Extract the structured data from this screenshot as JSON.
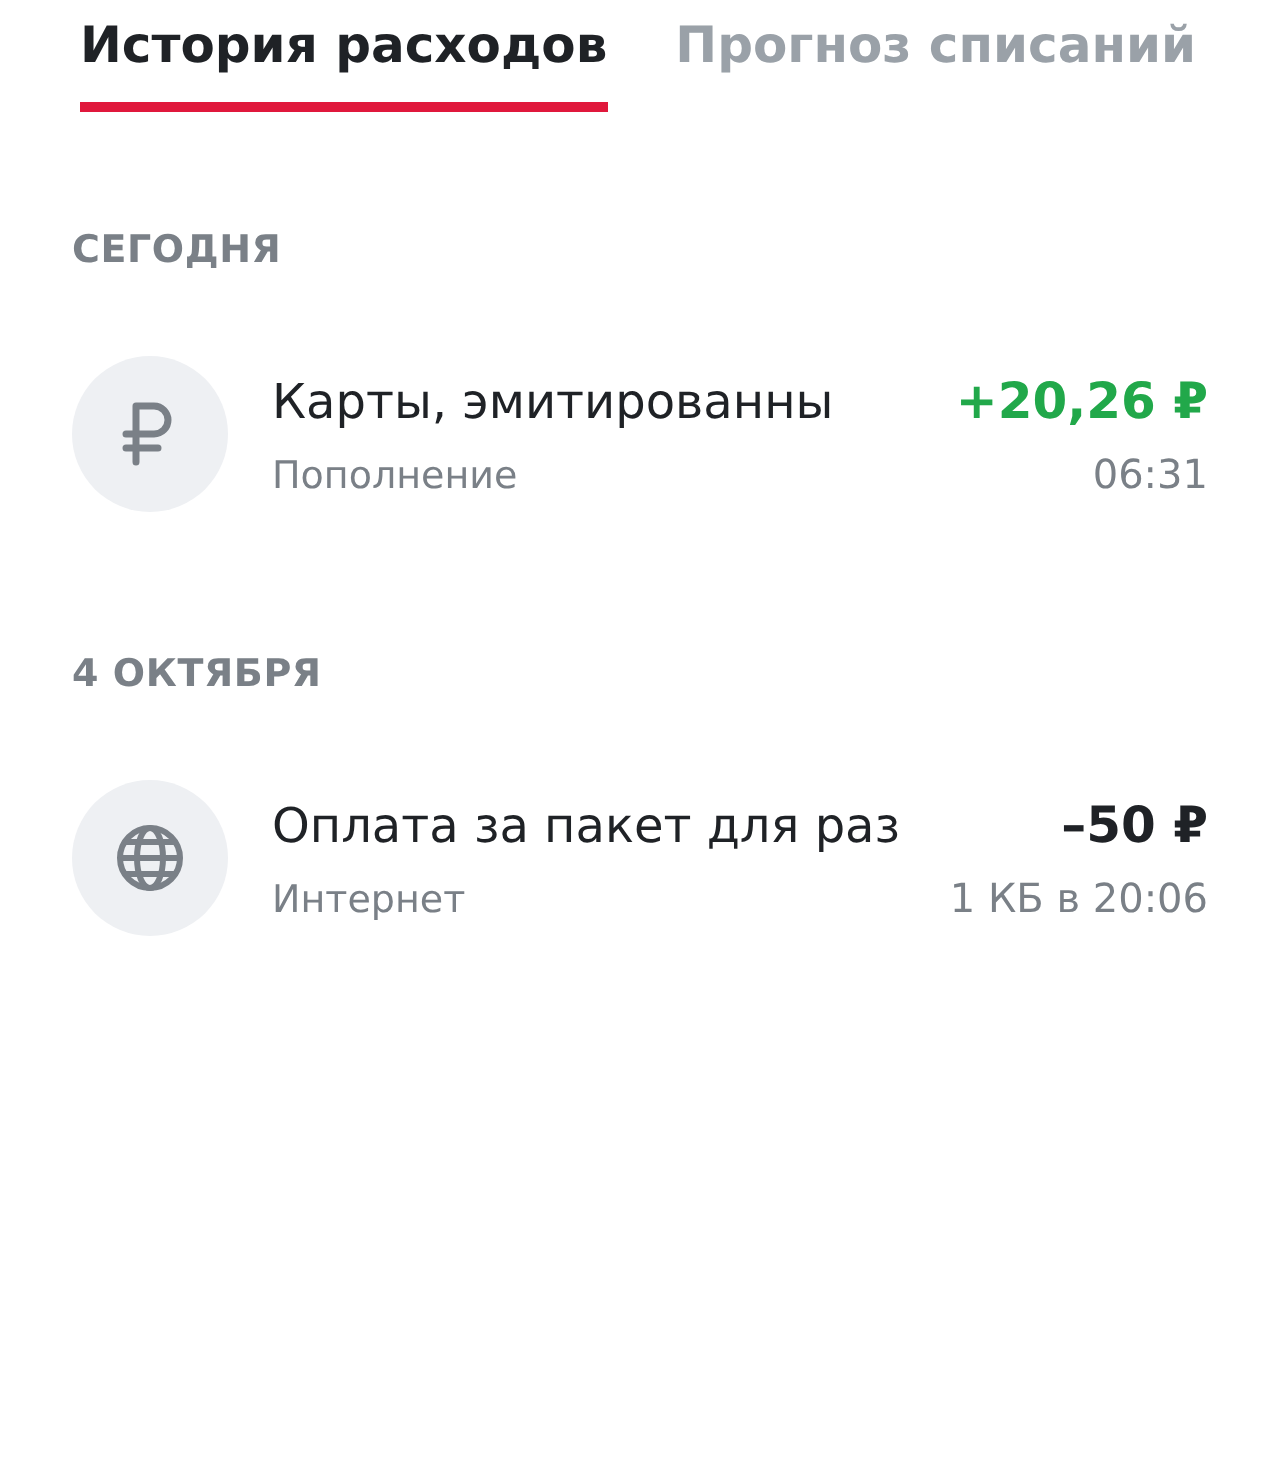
{
  "tabs": [
    {
      "label": "История расходов",
      "selected": true
    },
    {
      "label": "Прогноз списаний",
      "selected": false
    }
  ],
  "sections": [
    {
      "title": "СЕГОДНЯ",
      "transactions": [
        {
          "kind": "income",
          "title": "Карты, эмитированны",
          "subtitle": "Пополнение",
          "amount": "+20,26 ₽",
          "detail": "06:31"
        }
      ]
    },
    {
      "title": "4 ОКТЯБРЯ",
      "transactions": [
        {
          "kind": "payment",
          "title": "Оплата за пакет для раз",
          "subtitle": "Интернет",
          "amount": "–50 ₽",
          "detail": "1 КБ в 20:06"
        }
      ]
    }
  ]
}
